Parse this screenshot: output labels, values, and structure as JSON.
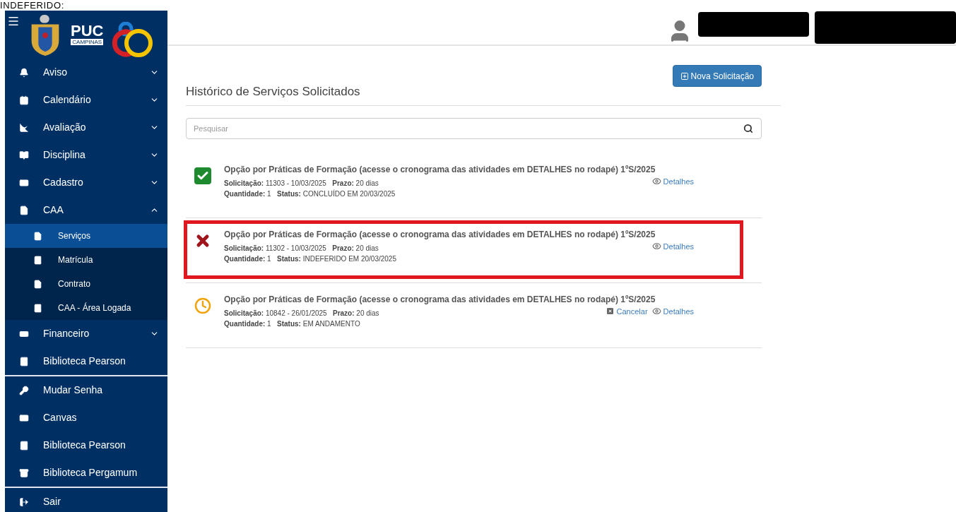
{
  "caption": "INDEFERIDO:",
  "logo": {
    "name": "PUC",
    "subtitle": "CAMPINAS"
  },
  "sidebar": {
    "groups": [
      [
        {
          "label": "Aviso",
          "expanded": false
        },
        {
          "label": "Calendário",
          "expanded": false
        },
        {
          "label": "Avaliação",
          "expanded": false
        },
        {
          "label": "Disciplina",
          "expanded": false
        },
        {
          "label": "Cadastro",
          "expanded": false
        },
        {
          "label": "CAA",
          "expanded": true,
          "children": [
            {
              "label": "Serviços",
              "selected": true
            },
            {
              "label": "Matrícula",
              "selected": false
            },
            {
              "label": "Contrato",
              "selected": false
            },
            {
              "label": "CAA - Área Logada",
              "selected": false
            }
          ]
        },
        {
          "label": "Financeiro",
          "expanded": false
        },
        {
          "label": "Biblioteca Pearson"
        }
      ],
      [
        {
          "label": "Mudar Senha"
        },
        {
          "label": "Canvas"
        },
        {
          "label": "Biblioteca Pearson"
        },
        {
          "label": "Biblioteca Pergamum"
        }
      ],
      [
        {
          "label": "Sair"
        }
      ]
    ]
  },
  "new_button": "Nova Solicitação",
  "title": "Histórico de Serviços Solicitados",
  "search": {
    "placeholder": "Pesquisar"
  },
  "requests": [
    {
      "kind": "done",
      "highlighted": false,
      "title": "Opção por Práticas de Formação (acesse o cronograma das atividades em DETALHES no rodapé) 1ºS/2025",
      "line_1": "**Solicitação:** 11303 - 10/03/2025   **Prazo:** 20 dias",
      "line_2": "**Quantidade:** 1   **Status:** CONCLUÍDO EM 20/03/2025",
      "actions": [
        {
          "kind": "details",
          "label": "Detalhes"
        }
      ]
    },
    {
      "kind": "rejected",
      "highlighted": true,
      "title": "Opção por Práticas de Formação (acesse o cronograma das atividades em DETALHES no rodapé) 1ºS/2025",
      "line_1": "**Solicitação:** 11302 - 10/03/2025   **Prazo:** 20 dias",
      "line_2": "**Quantidade:** 1   **Status:** INDEFERIDO EM 20/03/2025",
      "actions": [
        {
          "kind": "details",
          "label": "Detalhes"
        }
      ]
    },
    {
      "kind": "pending",
      "highlighted": false,
      "title": "Opção por Práticas de Formação (acesse o cronograma das atividades em DETALHES no rodapé) 1ºS/2025",
      "line_1": "**Solicitação:** 10842 - 26/01/2025   **Prazo:** 20 dias",
      "line_2": "**Quantidade:** 1   **Status:** EM ANDAMENTO",
      "actions": [
        {
          "kind": "cancel",
          "label": "Cancelar"
        },
        {
          "kind": "details",
          "label": "Detalhes"
        }
      ]
    }
  ]
}
